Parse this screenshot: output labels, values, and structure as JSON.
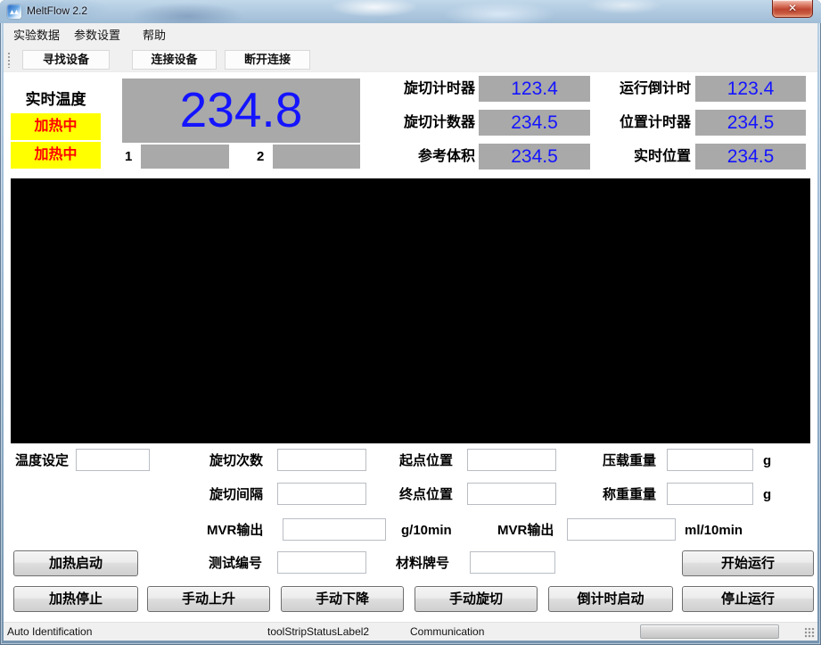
{
  "window": {
    "title": "MeltFlow 2.2"
  },
  "icons": {
    "close": "✕"
  },
  "menu": {
    "items": [
      {
        "label": "实验数据"
      },
      {
        "label": "参数设置"
      },
      {
        "label": "帮助"
      }
    ]
  },
  "toolbar": {
    "buttons": [
      {
        "label": "寻找设备"
      },
      {
        "label": "连接设备"
      },
      {
        "label": "断开连接"
      }
    ]
  },
  "temperature": {
    "label": "实时温度",
    "heating_status_1": "加热中",
    "heating_status_2": "加热中",
    "value": "234.8",
    "channel_1_label": "1",
    "channel_1_value": "",
    "channel_2_label": "2",
    "channel_2_value": ""
  },
  "counters": {
    "left": [
      {
        "label": "旋切计时器",
        "value": "123.4"
      },
      {
        "label": "旋切计数器",
        "value": "234.5"
      },
      {
        "label": "参考体积",
        "value": "234.5"
      }
    ],
    "right": [
      {
        "label": "运行倒计时",
        "value": "123.4"
      },
      {
        "label": "位置计时器",
        "value": "234.5"
      },
      {
        "label": "实时位置",
        "value": "234.5"
      }
    ]
  },
  "form": {
    "temp_set": {
      "label": "温度设定",
      "value": ""
    },
    "cut_count": {
      "label": "旋切次数",
      "value": ""
    },
    "cut_interval": {
      "label": "旋切间隔",
      "value": ""
    },
    "start_pos": {
      "label": "起点位置",
      "value": ""
    },
    "end_pos": {
      "label": "终点位置",
      "value": ""
    },
    "ballast_weight": {
      "label": "压载重量",
      "value": "",
      "unit": "g"
    },
    "weigh_weight": {
      "label": "称重重量",
      "value": "",
      "unit": "g"
    },
    "mvr_g": {
      "label": "MVR输出",
      "value": "",
      "unit": "g/10min"
    },
    "mvr_ml": {
      "label": "MVR输出",
      "value": "",
      "unit": "ml/10min"
    },
    "test_no": {
      "label": "测试编号",
      "value": ""
    },
    "material_no": {
      "label": "材料牌号",
      "value": ""
    }
  },
  "buttons": {
    "heat_start": "加热启动",
    "heat_stop": "加热停止",
    "manual_up": "手动上升",
    "manual_down": "手动下降",
    "manual_cut": "手动旋切",
    "countdown_start": "倒计时启动",
    "run_start": "开始运行",
    "run_stop": "停止运行"
  },
  "statusbar": {
    "item1": "Auto Identification",
    "item2": "toolStripStatusLabel2",
    "item3": "Communication"
  },
  "colors": {
    "value_blue": "#1414ff",
    "display_gray": "#a9a9a9",
    "heating_bg": "#ffff00",
    "heating_text": "#ff0000"
  }
}
